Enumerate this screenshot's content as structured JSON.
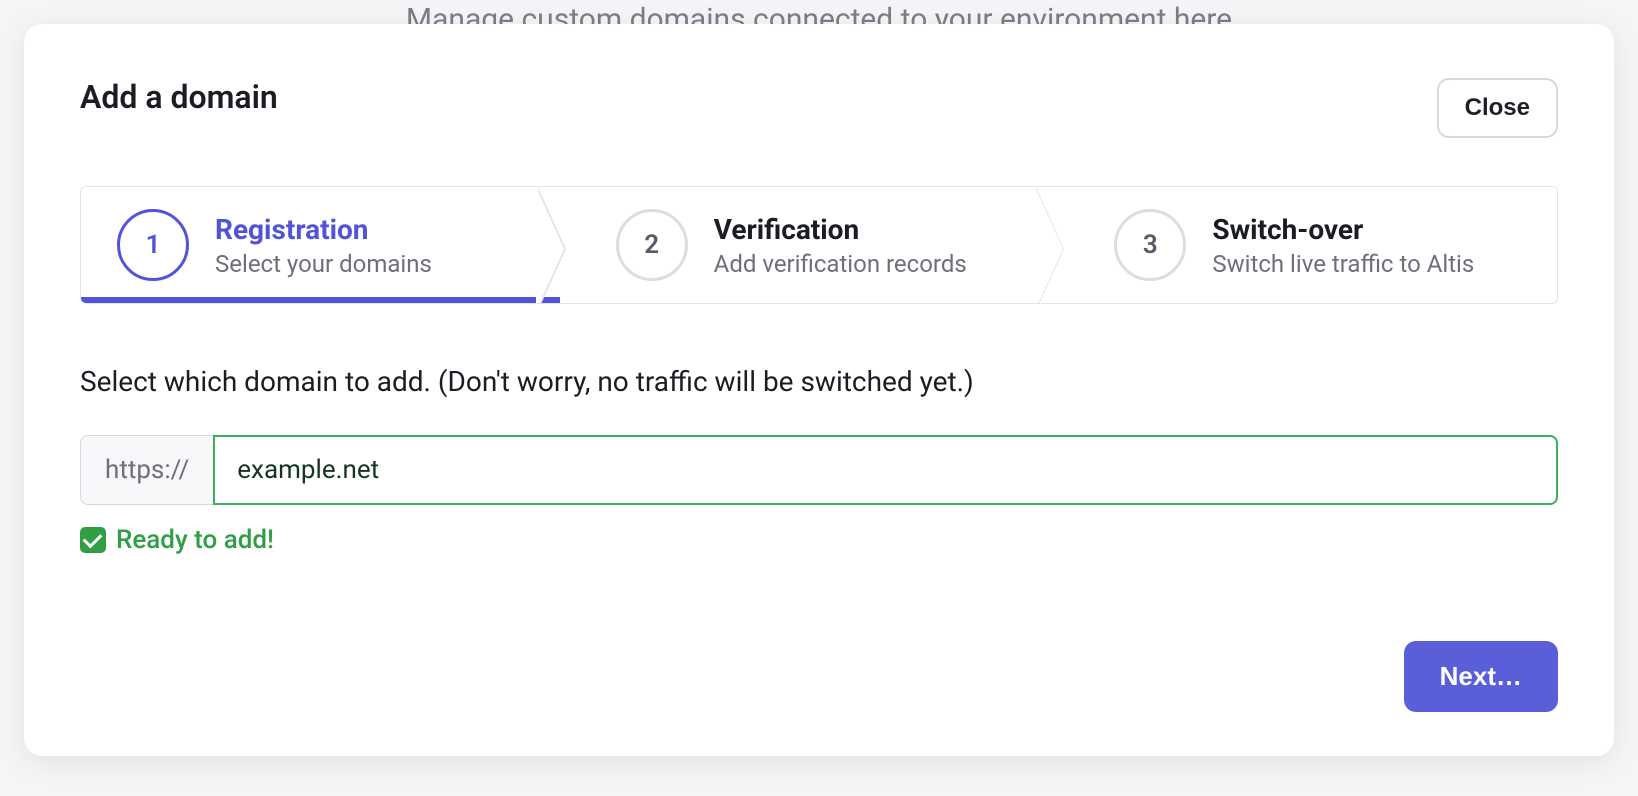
{
  "backdrop_hint": "Manage custom domains connected to your environment here",
  "modal": {
    "title": "Add a domain",
    "close_label": "Close"
  },
  "steps": [
    {
      "num": "1",
      "title": "Registration",
      "sub": "Select your domains"
    },
    {
      "num": "2",
      "title": "Verification",
      "sub": "Add verification records"
    },
    {
      "num": "3",
      "title": "Switch-over",
      "sub": "Switch live traffic to Altis"
    }
  ],
  "body": {
    "instruction": "Select which domain to add. (Don't worry, no traffic will be switched yet.)",
    "protocol_prefix": "https://",
    "domain_value": "example.net",
    "status_text": "Ready to add!"
  },
  "footer": {
    "next_label": "Next…"
  }
}
